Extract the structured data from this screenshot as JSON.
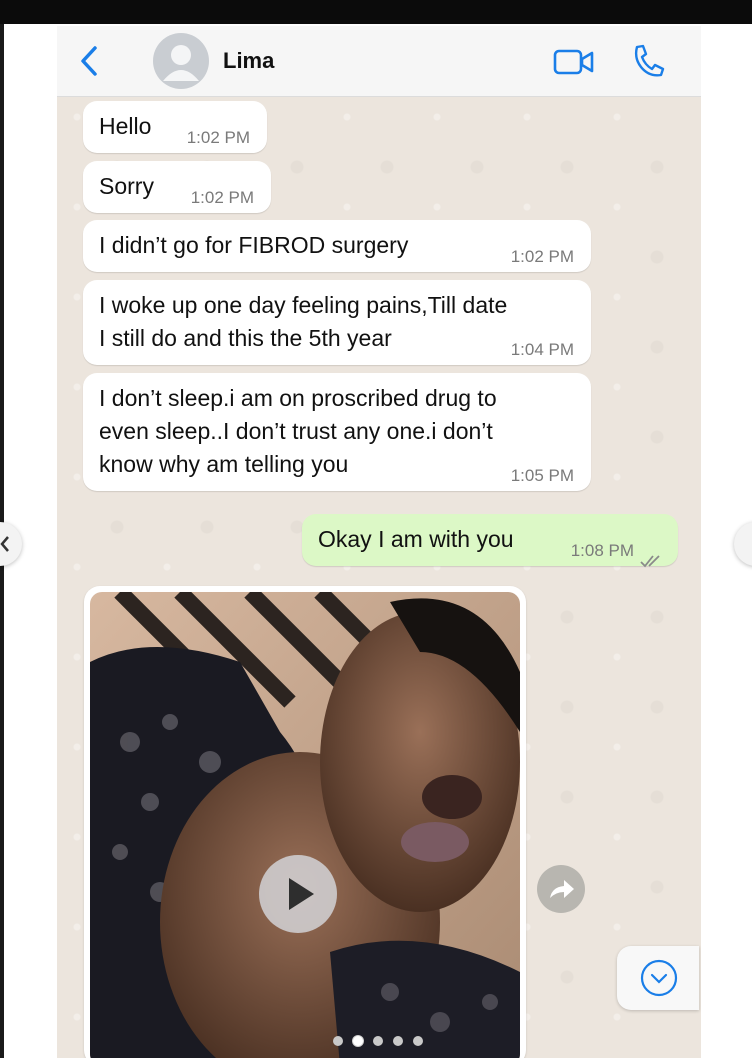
{
  "header": {
    "contact_name": "Lima"
  },
  "messages": [
    {
      "text": "Hello",
      "time": "1:02 PM",
      "direction": "in"
    },
    {
      "text": "Sorry",
      "time": "1:02 PM",
      "direction": "in"
    },
    {
      "text": "I didn’t go for FIBROD surgery",
      "time": "1:02 PM",
      "direction": "in"
    },
    {
      "text": "I woke up one day feeling pains,Till date\nI still do and this the 5th year",
      "time": "1:04 PM",
      "direction": "in"
    },
    {
      "text": "I don’t sleep.i am on proscribed drug to\neven sleep..I don’t trust any one.i don’t\nknow why am telling you",
      "time": "1:05 PM",
      "direction": "in"
    },
    {
      "text": "Okay I am with you",
      "time": "1:08 PM",
      "direction": "out",
      "status": "read"
    }
  ],
  "media_message": {
    "type": "video"
  },
  "carousel": {
    "total": 5,
    "active_index": 1
  },
  "colors": {
    "incoming_bubble": "#ffffff",
    "outgoing_bubble": "#dcf8c6",
    "chat_background": "#ece5dd",
    "accent_blue": "#1a7ee8"
  },
  "icons": [
    "back-chevron-icon",
    "avatar-placeholder-icon",
    "video-camera-icon",
    "phone-icon",
    "play-icon",
    "forward-share-icon",
    "scroll-down-icon",
    "double-check-icon"
  ]
}
